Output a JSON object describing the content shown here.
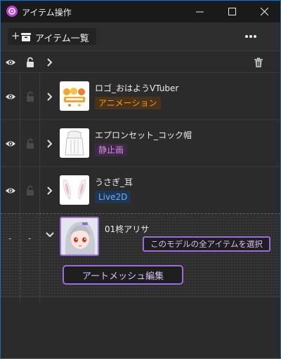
{
  "window": {
    "title": "アイテム操作",
    "app_icon": "app-logo-icon",
    "controls": [
      "minimize-icon",
      "maximize-icon",
      "close-icon"
    ]
  },
  "header": {
    "add_prefix": "+",
    "add_icon": "item-box-icon",
    "add_label": "アイテム一覧",
    "more_icon": "more-dots-icon"
  },
  "columns": {
    "visibility_icon": "eye-icon",
    "lock_icon": "unlock-icon",
    "expand_icon": "chevron-right-icon",
    "delete_icon": "trash-icon"
  },
  "items": [
    {
      "name": "ロゴ_おはようVTuber",
      "type": "アニメーション",
      "thumb_icon": "logo-thumbnail"
    },
    {
      "name": "エプロンセット_コック帽",
      "type": "静止画",
      "thumb_icon": "apron-thumbnail"
    },
    {
      "name": "うさぎ_耳",
      "type": "Live2D",
      "thumb_icon": "rabbit-ears-thumbnail"
    }
  ],
  "selected_item": {
    "name": "01柊アリサ",
    "visibility": "-",
    "lock": "-",
    "select_all_label": "このモデルの全アイテムを選択",
    "artmesh_label": "アートメッシュ編集",
    "thumb_icon": "avatar-thumbnail"
  },
  "colors": {
    "accent": "#9b6ce0",
    "animation_badge": "#ee9a2f",
    "still_badge": "#d68ae8",
    "live2d_badge": "#6eb0ee",
    "window_border": "#1a6fb0"
  }
}
